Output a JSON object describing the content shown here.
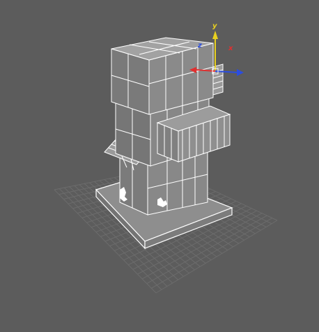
{
  "viewport": {
    "name": "3d-perspective-viewport",
    "background": "#5c5c5c",
    "grid_color": "#6c6c6c",
    "wire_color": "#ffffff",
    "shade_light": "#8a8a8a",
    "shade_dark": "#727272"
  },
  "scene": {
    "object": "building-model",
    "display_mode": "edged-faces"
  },
  "gizmo": {
    "labels": {
      "x": "x",
      "y": "y",
      "z": "z"
    },
    "colors": {
      "x": "#e03030",
      "y": "#e8d020",
      "z": "#2b4de0"
    }
  }
}
